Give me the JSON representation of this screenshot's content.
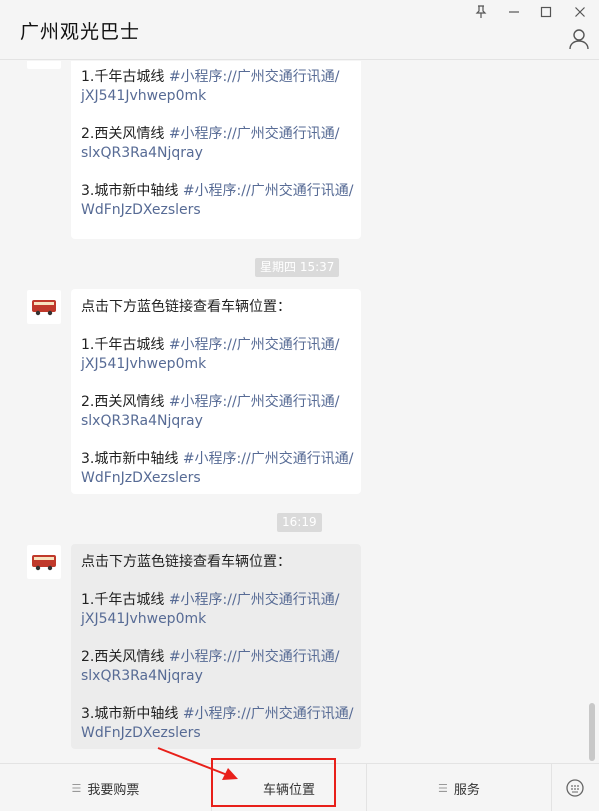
{
  "window": {
    "title": "广州观光巴士",
    "buttons": [
      "pin",
      "minimize",
      "maximize",
      "close"
    ]
  },
  "messages": [
    {
      "intro": "",
      "items": [
        {
          "label": "1.千年古城线",
          "link1": "#小程序://广州交通行讯通/",
          "link2": "jXJ541Jvhwep0mk"
        },
        {
          "label": "2.西关风情线",
          "link1": "#小程序://广州交通行讯通/",
          "link2": "slxQR3Ra4Njqray"
        },
        {
          "label": "3.城市新中轴线",
          "link1": "#小程序://广州交通行讯通/",
          "link2": "WdFnJzDXezslers"
        }
      ]
    },
    {
      "timestamp": "星期四 15:37",
      "intro": "点击下方蓝色链接查看车辆位置：",
      "items": [
        {
          "label": "1.千年古城线",
          "link1": "#小程序://广州交通行讯通/",
          "link2": "jXJ541Jvhwep0mk"
        },
        {
          "label": "2.西关风情线",
          "link1": "#小程序://广州交通行讯通/",
          "link2": "slxQR3Ra4Njqray"
        },
        {
          "label": "3.城市新中轴线",
          "link1": "#小程序://广州交通行讯通/",
          "link2": "WdFnJzDXezslers"
        }
      ]
    },
    {
      "timestamp": "16:19",
      "intro": "点击下方蓝色链接查看车辆位置：",
      "items": [
        {
          "label": "1.千年古城线",
          "link1": "#小程序://广州交通行讯通/",
          "link2": "jXJ541Jvhwep0mk"
        },
        {
          "label": "2.西关风情线",
          "link1": "#小程序://广州交通行讯通/",
          "link2": "slxQR3Ra4Njqray"
        },
        {
          "label": "3.城市新中轴线",
          "link1": "#小程序://广州交通行讯通/",
          "link2": "WdFnJzDXezslers"
        }
      ]
    }
  ],
  "menu": {
    "item1": "我要购票",
    "item2": "车辆位置",
    "item3": "服务",
    "item1_icon": "menu-lines-icon",
    "item3_icon": "menu-lines-icon",
    "keyboard_icon": "keyboard-toggle-icon"
  },
  "colors": {
    "link": "#576b95",
    "highlight": "#e8201a"
  }
}
